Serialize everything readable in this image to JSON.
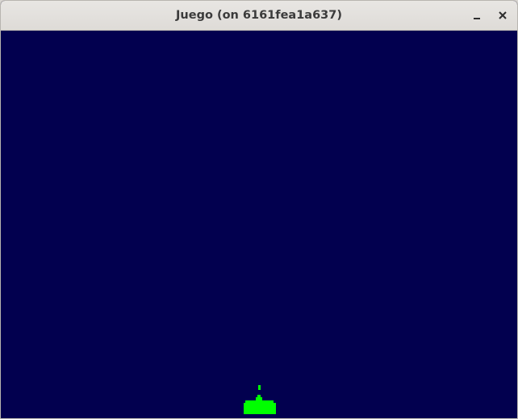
{
  "window": {
    "title": "Juego (on 6161fea1a637)"
  },
  "colors": {
    "background": "#02004f",
    "player": "#00ff00",
    "titlebar": "#e2dfdb"
  },
  "icons": {
    "minimize": "minimize-icon",
    "close": "close-icon"
  },
  "game": {
    "player": "ship",
    "projectiles": 1
  }
}
